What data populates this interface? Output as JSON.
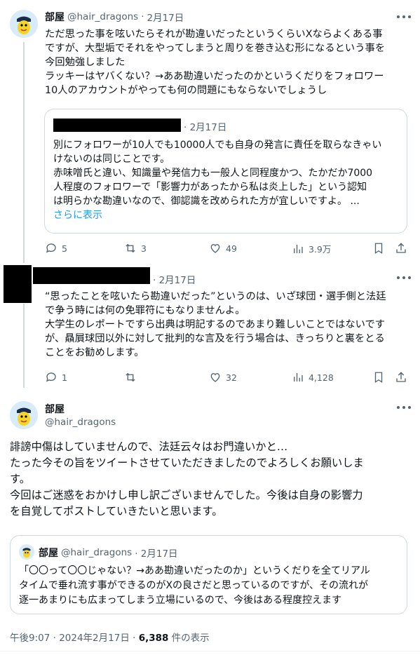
{
  "tweet1": {
    "name": "部屋",
    "handle": "@hair_dragons",
    "sep": "·",
    "date": "2月17日",
    "lines": [
      "ただ思った事を呟いたらそれが勘違いだったというくらいXならよくある事",
      "ですが、大型垢でそれをやってしまうと周りを巻き込む形になるという事を",
      "今回勉強しました",
      "ラッキーはヤバくない？→ああ勘違いだったのかというくだりをフォロワー",
      "10人のアカウントがやっても何の問題にもならないでしょうし"
    ],
    "quote": {
      "date": "· 2月17日",
      "lines": [
        "別にフォロワーが10人でも10000人でも自身の発言に責任を取らなきゃい",
        "けないのは同じことです。",
        "赤味噌氏と違い、知識量や発信力も一般人と同程度かつ、たかだか7000",
        "人程度のフォロワーで「影響力があったから私は炎上した」という認知",
        "は明らかな勘違いなので、御認識を改められた方が宜しいですよ。 ..."
      ],
      "show_more": "さらに表示"
    },
    "actions": {
      "replies": "5",
      "retweets": "3",
      "likes": "49",
      "views": "3.9万"
    }
  },
  "tweet2": {
    "date": "· 2月17日",
    "lines": [
      "“思ったことを呟いたら勘違いだった”というのは、いざ球団・選手側と法廷",
      "で争う時には何の免罪符にもなりませんよ。",
      "大学生のレポートですら出典は明記するのであまり難しいことではないです",
      "が、贔屓球団以外に対して批判的な言及を行う場合は、きっちりと裏をとる",
      "ことをお勧めします。"
    ],
    "actions": {
      "replies": "1",
      "retweets": "",
      "likes": "32",
      "views": "4,128"
    }
  },
  "tweet3": {
    "name": "部屋",
    "handle": "@hair_dragons",
    "lines": [
      "誹謗中傷はしていませんので、法廷云々はお門違いかと…",
      "たった今その旨をツイートさせていただきましたのでよろしくお願いしま",
      "す。",
      "今回はご迷惑をおかけし申し訳ございませんでした。今後は自身の影響力",
      "を自覚してポストしていきたいと思います。"
    ],
    "quote": {
      "name": "部屋",
      "handle": "@hair_dragons",
      "date": "· 2月17日",
      "lines": [
        "「〇〇って〇〇じゃない？→ああ勘違いだったのか」というくだりを全てリアル",
        "タイムで垂れ流す事ができるのがXの良さだと思っているのですが、その流れが",
        "逐一あまりにも広まってしまう立場にいるので、今後はある程度控えます"
      ]
    },
    "footer": {
      "time": "午後9:07 · 2024年2月17日 · ",
      "views": "6,388",
      "views_label": " 件の表示"
    }
  },
  "colors": {
    "link": "#1d9bf0",
    "muted": "#536471",
    "border": "#cfd9de"
  }
}
